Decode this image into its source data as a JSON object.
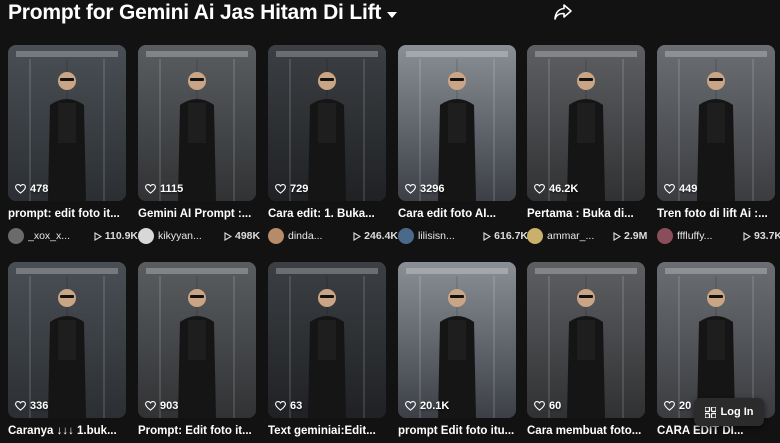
{
  "header": {
    "title": "Prompt for Gemini Ai Jas Hitam Di Lift"
  },
  "icons": {
    "share": "share-icon",
    "dropdown": "chevron-down-icon",
    "heart": "heart-icon",
    "play": "play-icon",
    "login": "grid-icon"
  },
  "colors": {
    "background": "#121212",
    "text": "#ffffff",
    "muted": "#dcdcdc"
  },
  "videos": [
    {
      "likes": "478",
      "caption": "prompt: edit foto it...",
      "user": "_xox_x...",
      "plays": "110.9K"
    },
    {
      "likes": "1115",
      "caption": "Gemini AI Prompt :...",
      "user": "kikyyan...",
      "plays": "498K"
    },
    {
      "likes": "729",
      "caption": "Cara edit: 1. Buka...",
      "user": "dinda...",
      "plays": "246.4K"
    },
    {
      "likes": "3296",
      "caption": "Cara edit foto AI...",
      "user": "lilisisn...",
      "plays": "616.7K"
    },
    {
      "likes": "46.2K",
      "caption": "Pertama : Buka di...",
      "user": "ammar_...",
      "plays": "2.9M"
    },
    {
      "likes": "449",
      "caption": "Tren foto di lift Ai :...",
      "user": "fffluffy...",
      "plays": "93.7K"
    },
    {
      "likes": "336",
      "caption": "Caranya ↓↓↓ 1.buk..."
    },
    {
      "likes": "903",
      "caption": "Prompt: Edit foto it..."
    },
    {
      "likes": "63",
      "caption": "Text geminiai:Edit..."
    },
    {
      "likes": "20.1K",
      "caption": "prompt Edit foto itu..."
    },
    {
      "likes": "60",
      "caption": "Cara membuat foto..."
    },
    {
      "likes": "20",
      "caption": "CARA EDIT DI..."
    }
  ],
  "login": {
    "label": "Log In"
  }
}
